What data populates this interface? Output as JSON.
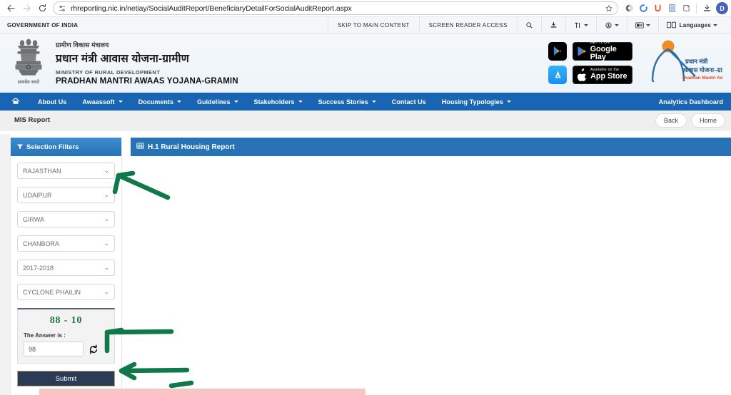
{
  "browser": {
    "url": "rhreporting.nic.in/netiay/SocialAuditReport/BeneficiaryDetailForSocialAuditReport.aspx",
    "back_icon": "back-arrow-icon",
    "forward_icon": "forward-arrow-icon",
    "reload_icon": "reload-icon",
    "site_info_icon": "site-settings-icon",
    "bookmark_icon": "star-icon",
    "extensions": [
      "extension-icon-1",
      "extension-icon-2",
      "extension-icon-u",
      "extension-icon-3",
      "extension-icon-4"
    ],
    "download_icon": "download-icon",
    "avatar_initial": "D"
  },
  "gov_bar": {
    "title": "GOVERNMENT OF INDIA",
    "links": [
      "SKIP TO MAIN CONTENT",
      "SCREEN READER ACCESS"
    ],
    "icons": [
      "search-icon",
      "download-icon",
      "text-size-icon",
      "accessibility-icon",
      "contrast-icon"
    ],
    "languages_label": "Languages"
  },
  "site_header": {
    "emblem_icon": "india-state-emblem-icon",
    "emblem_motto": "सत्यमेव जयते",
    "hindi_small": "ग्रामीण विकास मंत्रालय",
    "hindi_large": "प्रधान मंत्री आवास योजना-ग्रामीण",
    "english_small": "MINISTRY OF RURAL DEVELOPMENT",
    "english_large": "PRADHAN MANTRI AWAAS YOJANA-GRAMIN",
    "play_square_icon": "google-play-icon",
    "appstore_square_icon": "app-store-icon",
    "google_play": {
      "pre": "GET IT ON",
      "name": "Google Play"
    },
    "app_store": {
      "pre": "Available on the",
      "name": "App Store"
    },
    "pmay_logo": {
      "hindi_line1": "प्रधान मंत्री",
      "hindi_line2": "आवास योजना–ग्रामीण",
      "english": "Pradhan Mantri Awaas Yojana-Gramin"
    }
  },
  "navbar": {
    "home_icon": "home-icon",
    "items": [
      {
        "label": "About Us",
        "caret": false
      },
      {
        "label": "Awaassoft",
        "caret": true
      },
      {
        "label": "Documents",
        "caret": true
      },
      {
        "label": "Guidelines",
        "caret": true
      },
      {
        "label": "Stakeholders",
        "caret": true
      },
      {
        "label": "Success Stories",
        "caret": true
      },
      {
        "label": "Contact Us",
        "caret": false
      },
      {
        "label": "Housing Typologies",
        "caret": true
      }
    ],
    "right_item": "Analytics Dashboard"
  },
  "mis_bar": {
    "title": "MIS Report",
    "back_label": "Back",
    "home_label": "Home"
  },
  "filters": {
    "panel_title": "Selection Filters",
    "filter_icon": "funnel-icon",
    "selects": [
      {
        "name": "state",
        "value": "RAJASTHAN"
      },
      {
        "name": "district",
        "value": "UDAIPUR"
      },
      {
        "name": "block",
        "value": "GIRWA"
      },
      {
        "name": "panchayat",
        "value": "CHANBORA"
      },
      {
        "name": "financial-year",
        "value": "2017-2018"
      },
      {
        "name": "scheme",
        "value": "CYCLONE PHAILIN"
      }
    ],
    "captcha": {
      "question": "88 - 10",
      "answer_label": "The Answer is :",
      "answer_value": "98",
      "refresh_icon": "refresh-icon"
    },
    "submit_label": "Submit"
  },
  "report": {
    "icon": "table-icon",
    "title": "H.1 Rural Housing Report"
  },
  "annotations": {
    "arrow_1": "green-arrow-pointing-to-state-dropdown",
    "arrow_2": "green-arrow-pointing-to-captcha-refresh",
    "arrow_3": "green-arrow-pointing-to-submit-button"
  },
  "colors": {
    "navbar_blue": "#1866b3",
    "report_header_blue": "#2873b5",
    "submit_navy": "#2b3a55",
    "captcha_green": "#1d7a3c",
    "annotation_green": "#10794a"
  }
}
